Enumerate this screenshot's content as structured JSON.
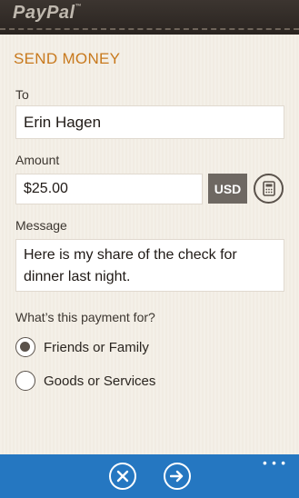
{
  "app": {
    "logo_text": "PayPal",
    "logo_tm": "™"
  },
  "page": {
    "title": "SEND MONEY"
  },
  "form": {
    "to_label": "To",
    "to_value": "Erin Hagen",
    "amount_label": "Amount",
    "amount_value": "$25.00",
    "currency_button": "USD",
    "message_label": "Message",
    "message_line1": "Here is my share of the check for",
    "message_line2": "dinner last night.",
    "purpose_label": "What’s this payment for?",
    "options": [
      {
        "label": "Friends or Family",
        "selected": true
      },
      {
        "label": "Goods or Services",
        "selected": false
      }
    ]
  },
  "appbar": {
    "more": "• • •",
    "cancel_icon": "close-icon",
    "send_icon": "arrow-right-icon"
  },
  "colors": {
    "accent": "#c8791d",
    "appbar": "#2577c1",
    "currency_bg": "#6e6862"
  }
}
